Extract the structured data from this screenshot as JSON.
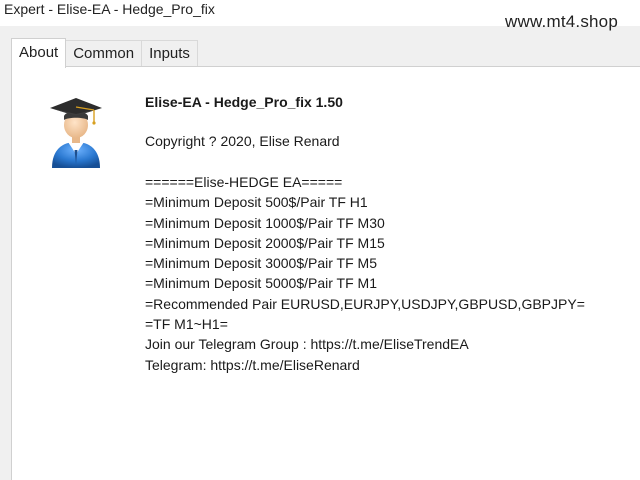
{
  "window": {
    "title": "Expert - Elise-EA - Hedge_Pro_fix",
    "watermark": "www.mt4.shop"
  },
  "tabs": [
    {
      "label": "About",
      "active": true
    },
    {
      "label": "Common",
      "active": false
    },
    {
      "label": "Inputs",
      "active": false
    }
  ],
  "about": {
    "icon": "graduate-user-icon",
    "name": "Elise-EA - Hedge_Pro_fix 1.50",
    "copyright": "Copyright ? 2020, Elise Renard",
    "description": [
      "======Elise-HEDGE EA=====",
      "=Minimum Deposit 500$/Pair TF H1",
      "=Minimum Deposit 1000$/Pair TF M30",
      "=Minimum Deposit 2000$/Pair TF M15",
      "=Minimum Deposit 3000$/Pair TF M5",
      "=Minimum Deposit 5000$/Pair TF M1",
      "=Recommended Pair EURUSD,EURJPY,USDJPY,GBPUSD,GBPJPY=",
      "=TF M1~H1=",
      "Join our Telegram Group : https://t.me/EliseTrendEA",
      "Telegram: https://t.me/EliseRenard"
    ]
  },
  "colors": {
    "background": "#f0f0f0",
    "panel": "#ffffff",
    "icon_blue": "#2a78d0",
    "cap_dark": "#2c2c2c"
  }
}
